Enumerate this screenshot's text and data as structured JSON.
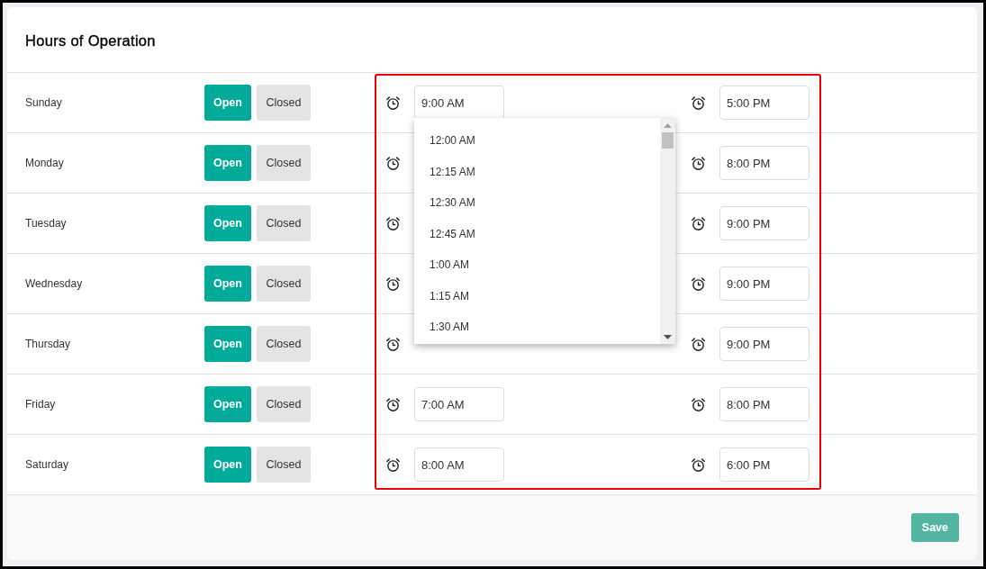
{
  "title": "Hours of Operation",
  "days": [
    {
      "day": "Sunday",
      "status_options": [
        {
          "label": "Open",
          "selected": true
        },
        {
          "label": "Closed",
          "selected": false
        }
      ],
      "open_time": "9:00 AM",
      "open_dropdown": {
        "options": [
          {
            "label": "12:00 AM",
            "selected": false
          },
          {
            "label": "12:15 AM",
            "selected": false
          },
          {
            "label": "12:30 AM",
            "selected": false
          },
          {
            "label": "12:45 AM",
            "selected": false
          },
          {
            "label": "1:00 AM",
            "selected": false
          },
          {
            "label": "1:15 AM",
            "selected": false
          },
          {
            "label": "1:30 AM",
            "selected": false
          }
        ]
      },
      "close_time": "5:00 PM"
    },
    {
      "day": "Monday",
      "status_options": [
        {
          "label": "Open",
          "selected": true
        },
        {
          "label": "Closed",
          "selected": false
        }
      ],
      "close_time": "8:00 PM"
    },
    {
      "day": "Tuesday",
      "status_options": [
        {
          "label": "Open",
          "selected": true
        },
        {
          "label": "Closed",
          "selected": false
        }
      ],
      "close_time": "9:00 PM"
    },
    {
      "day": "Wednesday",
      "status_options": [
        {
          "label": "Open",
          "selected": true
        },
        {
          "label": "Closed",
          "selected": false
        }
      ],
      "close_time": "9:00 PM"
    },
    {
      "day": "Thursday",
      "status_options": [
        {
          "label": "Open",
          "selected": true
        },
        {
          "label": "Closed",
          "selected": false
        }
      ],
      "close_time": "9:00 PM"
    },
    {
      "day": "Friday",
      "status_options": [
        {
          "label": "Open",
          "selected": true
        },
        {
          "label": "Closed",
          "selected": false
        }
      ],
      "open_time": "7:00 AM",
      "close_time": "8:00 PM"
    },
    {
      "day": "Saturday",
      "status_options": [
        {
          "label": "Open",
          "selected": true
        },
        {
          "label": "Closed",
          "selected": false
        }
      ],
      "open_time": "8:00 AM",
      "close_time": "6:00 PM"
    }
  ],
  "save_button": {
    "label": "Save",
    "disabled": true
  }
}
